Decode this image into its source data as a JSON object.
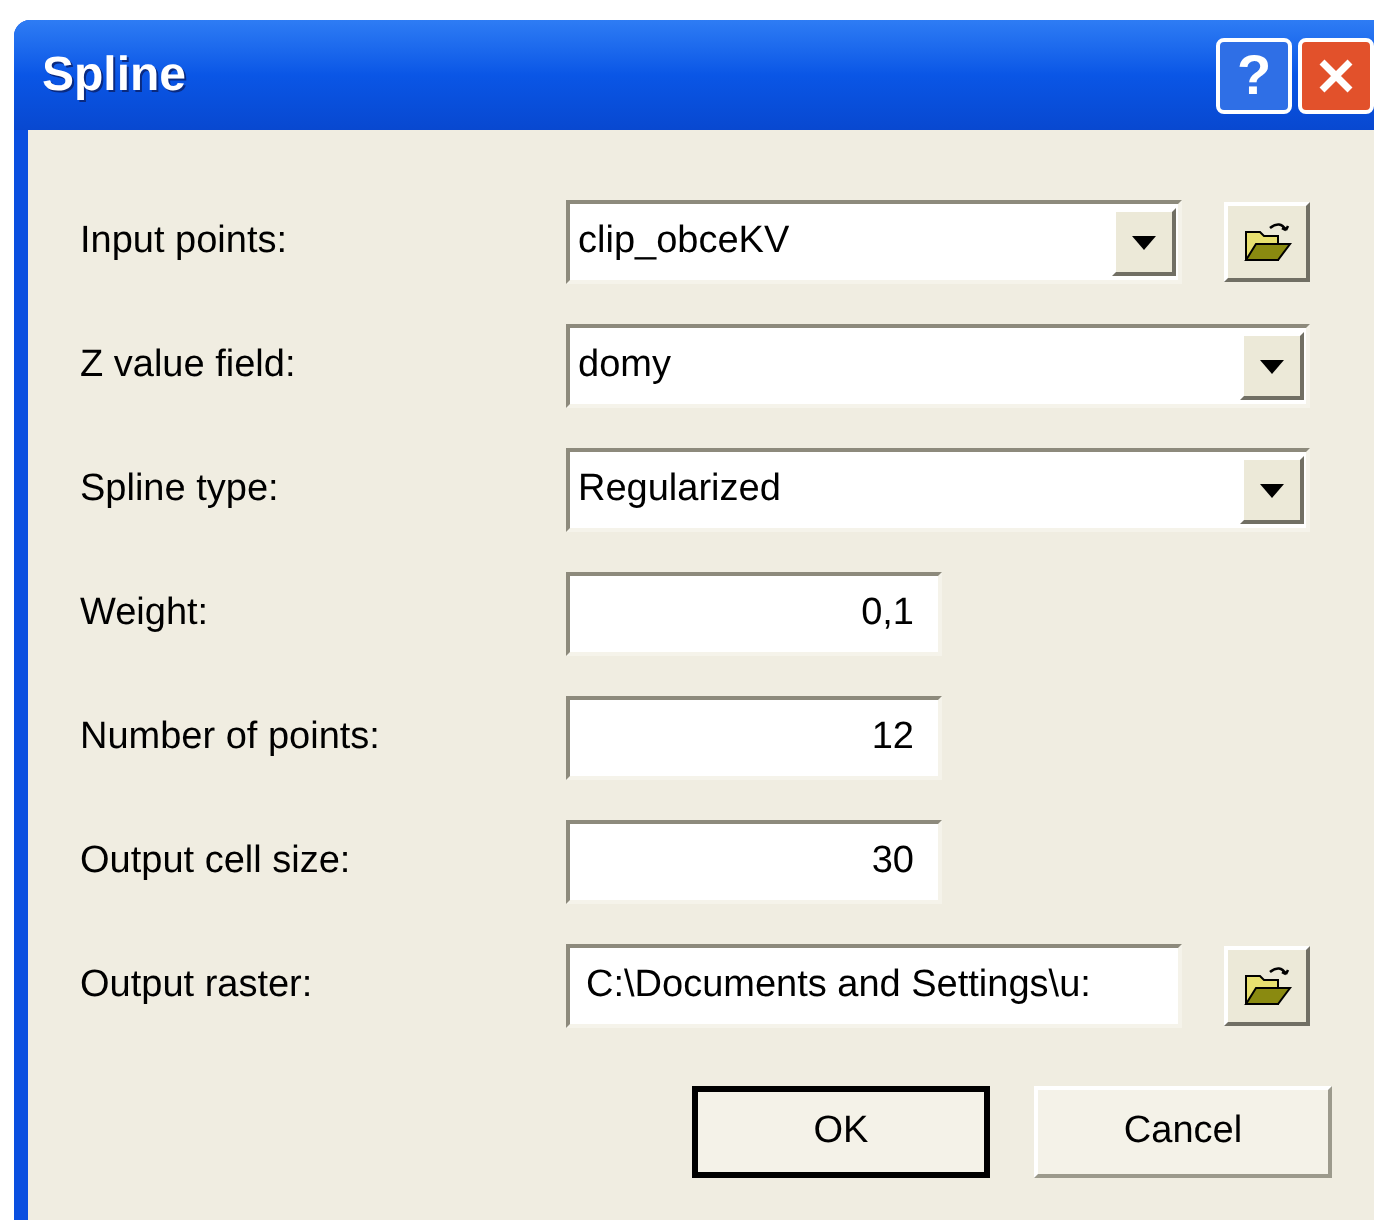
{
  "window": {
    "title": "Spline",
    "help_button": "?"
  },
  "fields": [
    {
      "kind": "dropdown",
      "label": "Input points:",
      "value": "clip_obceKV",
      "browse": true
    },
    {
      "kind": "dropdown",
      "label": "Z value field:",
      "value": "domy",
      "browse": false
    },
    {
      "kind": "dropdown",
      "label": "Spline type:",
      "value": "Regularized",
      "browse": false
    },
    {
      "kind": "number",
      "label": "Weight:",
      "value": "0,1",
      "browse": false
    },
    {
      "kind": "number",
      "label": "Number of points:",
      "value": "12",
      "browse": false
    },
    {
      "kind": "number",
      "label": "Output cell size:",
      "value": "30",
      "browse": false
    },
    {
      "kind": "path",
      "label": "Output raster:",
      "value": "C:\\Documents and Settings\\u:",
      "browse": true
    }
  ],
  "buttons": [
    {
      "label": "OK",
      "default": true
    },
    {
      "label": "Cancel",
      "default": false
    }
  ]
}
